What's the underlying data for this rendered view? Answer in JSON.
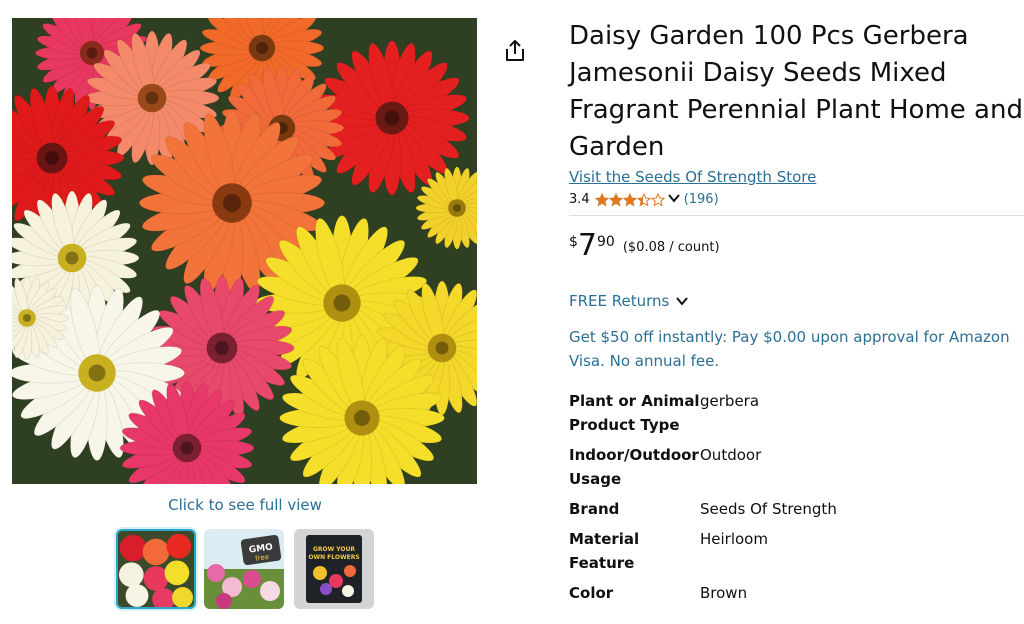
{
  "gallery": {
    "full_view_link": "Click to see full view",
    "thumbnails": [
      {
        "name": "thumbnail-gerbera-mix",
        "selected": true
      },
      {
        "name": "thumbnail-gmo-free-cosmos",
        "selected": false
      },
      {
        "name": "thumbnail-seed-packet",
        "selected": false,
        "text": "GROW YOUR OWN FLOWERS"
      }
    ],
    "thumbnail_badge": "GMO free"
  },
  "product": {
    "title": "Daisy Garden 100 Pcs Gerbera Jamesonii Daisy Seeds Mixed Fragrant Perennial Plant Home and Garden",
    "store_link": "Visit the Seeds Of Strength Store",
    "rating": {
      "value": "3.4",
      "stars": 3.4,
      "review_count": "(196)"
    },
    "price": {
      "symbol": "$",
      "whole": "7",
      "fraction": "90",
      "per_unit": "($0.08 / count)"
    },
    "returns": "FREE Returns",
    "promo": "Get $50 off instantly: Pay $0.00 upon approval for Amazon Visa. No annual fee.",
    "specs": [
      {
        "label": "Plant or Animal Product Type",
        "value": "gerbera"
      },
      {
        "label": "Indoor/Outdoor Usage",
        "value": "Outdoor"
      },
      {
        "label": "Brand",
        "value": "Seeds Of Strength"
      },
      {
        "label": "Material Feature",
        "value": "Heirloom"
      },
      {
        "label": "Color",
        "value": "Brown"
      }
    ]
  },
  "colors": {
    "link": "#2a6f94",
    "star": "#de7921",
    "selected_thumb_border": "#2aa6c8"
  },
  "icons": {
    "share": "share-icon",
    "returns_chevron": "chevron-down-icon",
    "rating_chevron": "chevron-down-icon"
  }
}
